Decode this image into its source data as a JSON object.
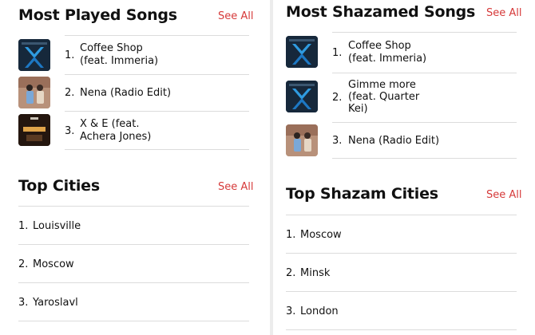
{
  "left": {
    "most_played": {
      "title": "Most Played Songs",
      "see_all": "See All",
      "songs": [
        {
          "rank": "1.",
          "title_line1": "Coffee Shop",
          "title_line2": "(feat. Immeria)",
          "art": "blue-x-cover"
        },
        {
          "rank": "2.",
          "title_line1": "Nena (Radio Edit)",
          "title_line2": "",
          "art": "nena-cover"
        },
        {
          "rank": "3.",
          "title_line1": "X & E (feat.",
          "title_line2": "Achera Jones)",
          "art": "treasure-cover"
        }
      ]
    },
    "top_cities": {
      "title": "Top Cities",
      "see_all": "See All",
      "cities": [
        {
          "rank": "1.",
          "name": "Louisville"
        },
        {
          "rank": "2.",
          "name": "Moscow"
        },
        {
          "rank": "3.",
          "name": "Yaroslavl"
        }
      ]
    }
  },
  "right": {
    "most_shazamed": {
      "title": "Most Shazamed Songs",
      "see_all": "See All",
      "songs": [
        {
          "rank": "1.",
          "title_line1": "Coffee Shop",
          "title_line2": "(feat. Immeria)",
          "title_line3": "",
          "art": "blue-x-cover"
        },
        {
          "rank": "2.",
          "title_line1": "Gimme more",
          "title_line2": "(feat. Quarter",
          "title_line3": "Kei)",
          "art": "blue-x-cover"
        },
        {
          "rank": "3.",
          "title_line1": "Nena (Radio Edit)",
          "title_line2": "",
          "title_line3": "",
          "art": "nena-cover"
        }
      ]
    },
    "top_shazam_cities": {
      "title": "Top Shazam Cities",
      "see_all": "See All",
      "cities": [
        {
          "rank": "1.",
          "name": "Moscow"
        },
        {
          "rank": "2.",
          "name": "Minsk"
        },
        {
          "rank": "3.",
          "name": "London"
        }
      ]
    }
  },
  "colors": {
    "accent": "#d63a3a",
    "divider": "#dcdcdc"
  }
}
